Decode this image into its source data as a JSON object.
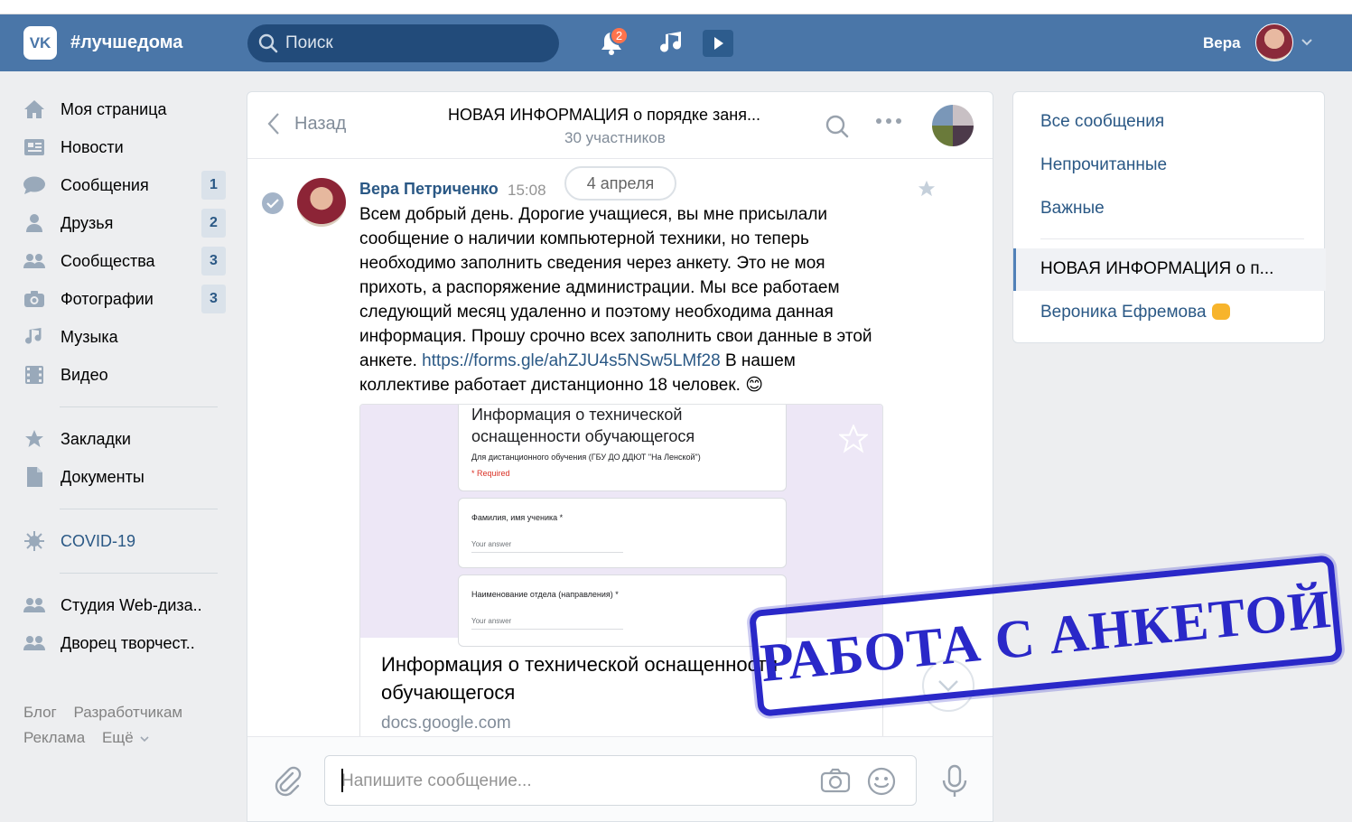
{
  "header": {
    "logo": "VK",
    "brand": "#лучшедома",
    "search_placeholder": "Поиск",
    "notifications_count": "2",
    "user_name": "Вера",
    "accent": "#4a76a8"
  },
  "sidebar": {
    "items": [
      {
        "label": "Моя страница",
        "icon": "home-icon",
        "count": ""
      },
      {
        "label": "Новости",
        "icon": "news-icon",
        "count": ""
      },
      {
        "label": "Сообщения",
        "icon": "messages-icon",
        "count": "1"
      },
      {
        "label": "Друзья",
        "icon": "friends-icon",
        "count": "2"
      },
      {
        "label": "Сообщества",
        "icon": "communities-icon",
        "count": "3"
      },
      {
        "label": "Фотографии",
        "icon": "camera-icon",
        "count": "3"
      },
      {
        "label": "Музыка",
        "icon": "music-icon",
        "count": ""
      },
      {
        "label": "Видео",
        "icon": "video-icon",
        "count": ""
      }
    ],
    "items2": [
      {
        "label": "Закладки",
        "icon": "star-icon"
      },
      {
        "label": "Документы",
        "icon": "document-icon"
      }
    ],
    "covid": "COVID-19",
    "groups": [
      {
        "label": "Студия Web-диза.."
      },
      {
        "label": "Дворец творчест.."
      }
    ],
    "footer": {
      "blog": "Блог",
      "dev": "Разработчикам",
      "ads": "Реклама",
      "more": "Ещё"
    }
  },
  "chat": {
    "back_label": "Назад",
    "title": "НОВАЯ ИНФОРМАЦИЯ  о порядке заня...",
    "members": "30 участников",
    "date": "4 апреля",
    "message": {
      "author": "Вера Петриченко",
      "time": "15:08",
      "text_before": "Всем добрый день. Дорогие учащиеся, вы мне присылали сообщение о наличии компьютерной техники, но теперь необходимо заполнить сведения через анкету. Это не моя прихоть, а распоряжение администрации. Мы все работаем следующий месяц удаленно и поэтому необходима данная информация. Прошу срочно всех заполнить свои данные в этой анкете. ",
      "link": "https://forms.gle/ahZJU4s5NSw5LMf28",
      "text_after": " В нашем коллективе работает дистанционно 18 человек. ",
      "emoji": "😊"
    },
    "attachment": {
      "form_title": "Информация о технической оснащенности обучающегося",
      "form_subtitle": "Для дистанционного обучения (ГБУ ДО ДДЮТ \"На Ленской\")",
      "required": "* Required",
      "field1": "Фамилия, имя ученика *",
      "field2": "Наименование отдела (направления) *",
      "answer_placeholder": "Your answer",
      "title": "Информация о технической оснащенности обучающегося",
      "domain": "docs.google.com"
    },
    "composer_placeholder": "Напишите сообщение..."
  },
  "right": {
    "all": "Все сообщения",
    "unread": "Непрочитанные",
    "important": "Важные",
    "active_chat": "НОВАЯ ИНФОРМАЦИЯ  о п...",
    "other_chat": "Вероника Ефремова"
  },
  "stamp": "РАБОТА С АНКЕТОЙ"
}
